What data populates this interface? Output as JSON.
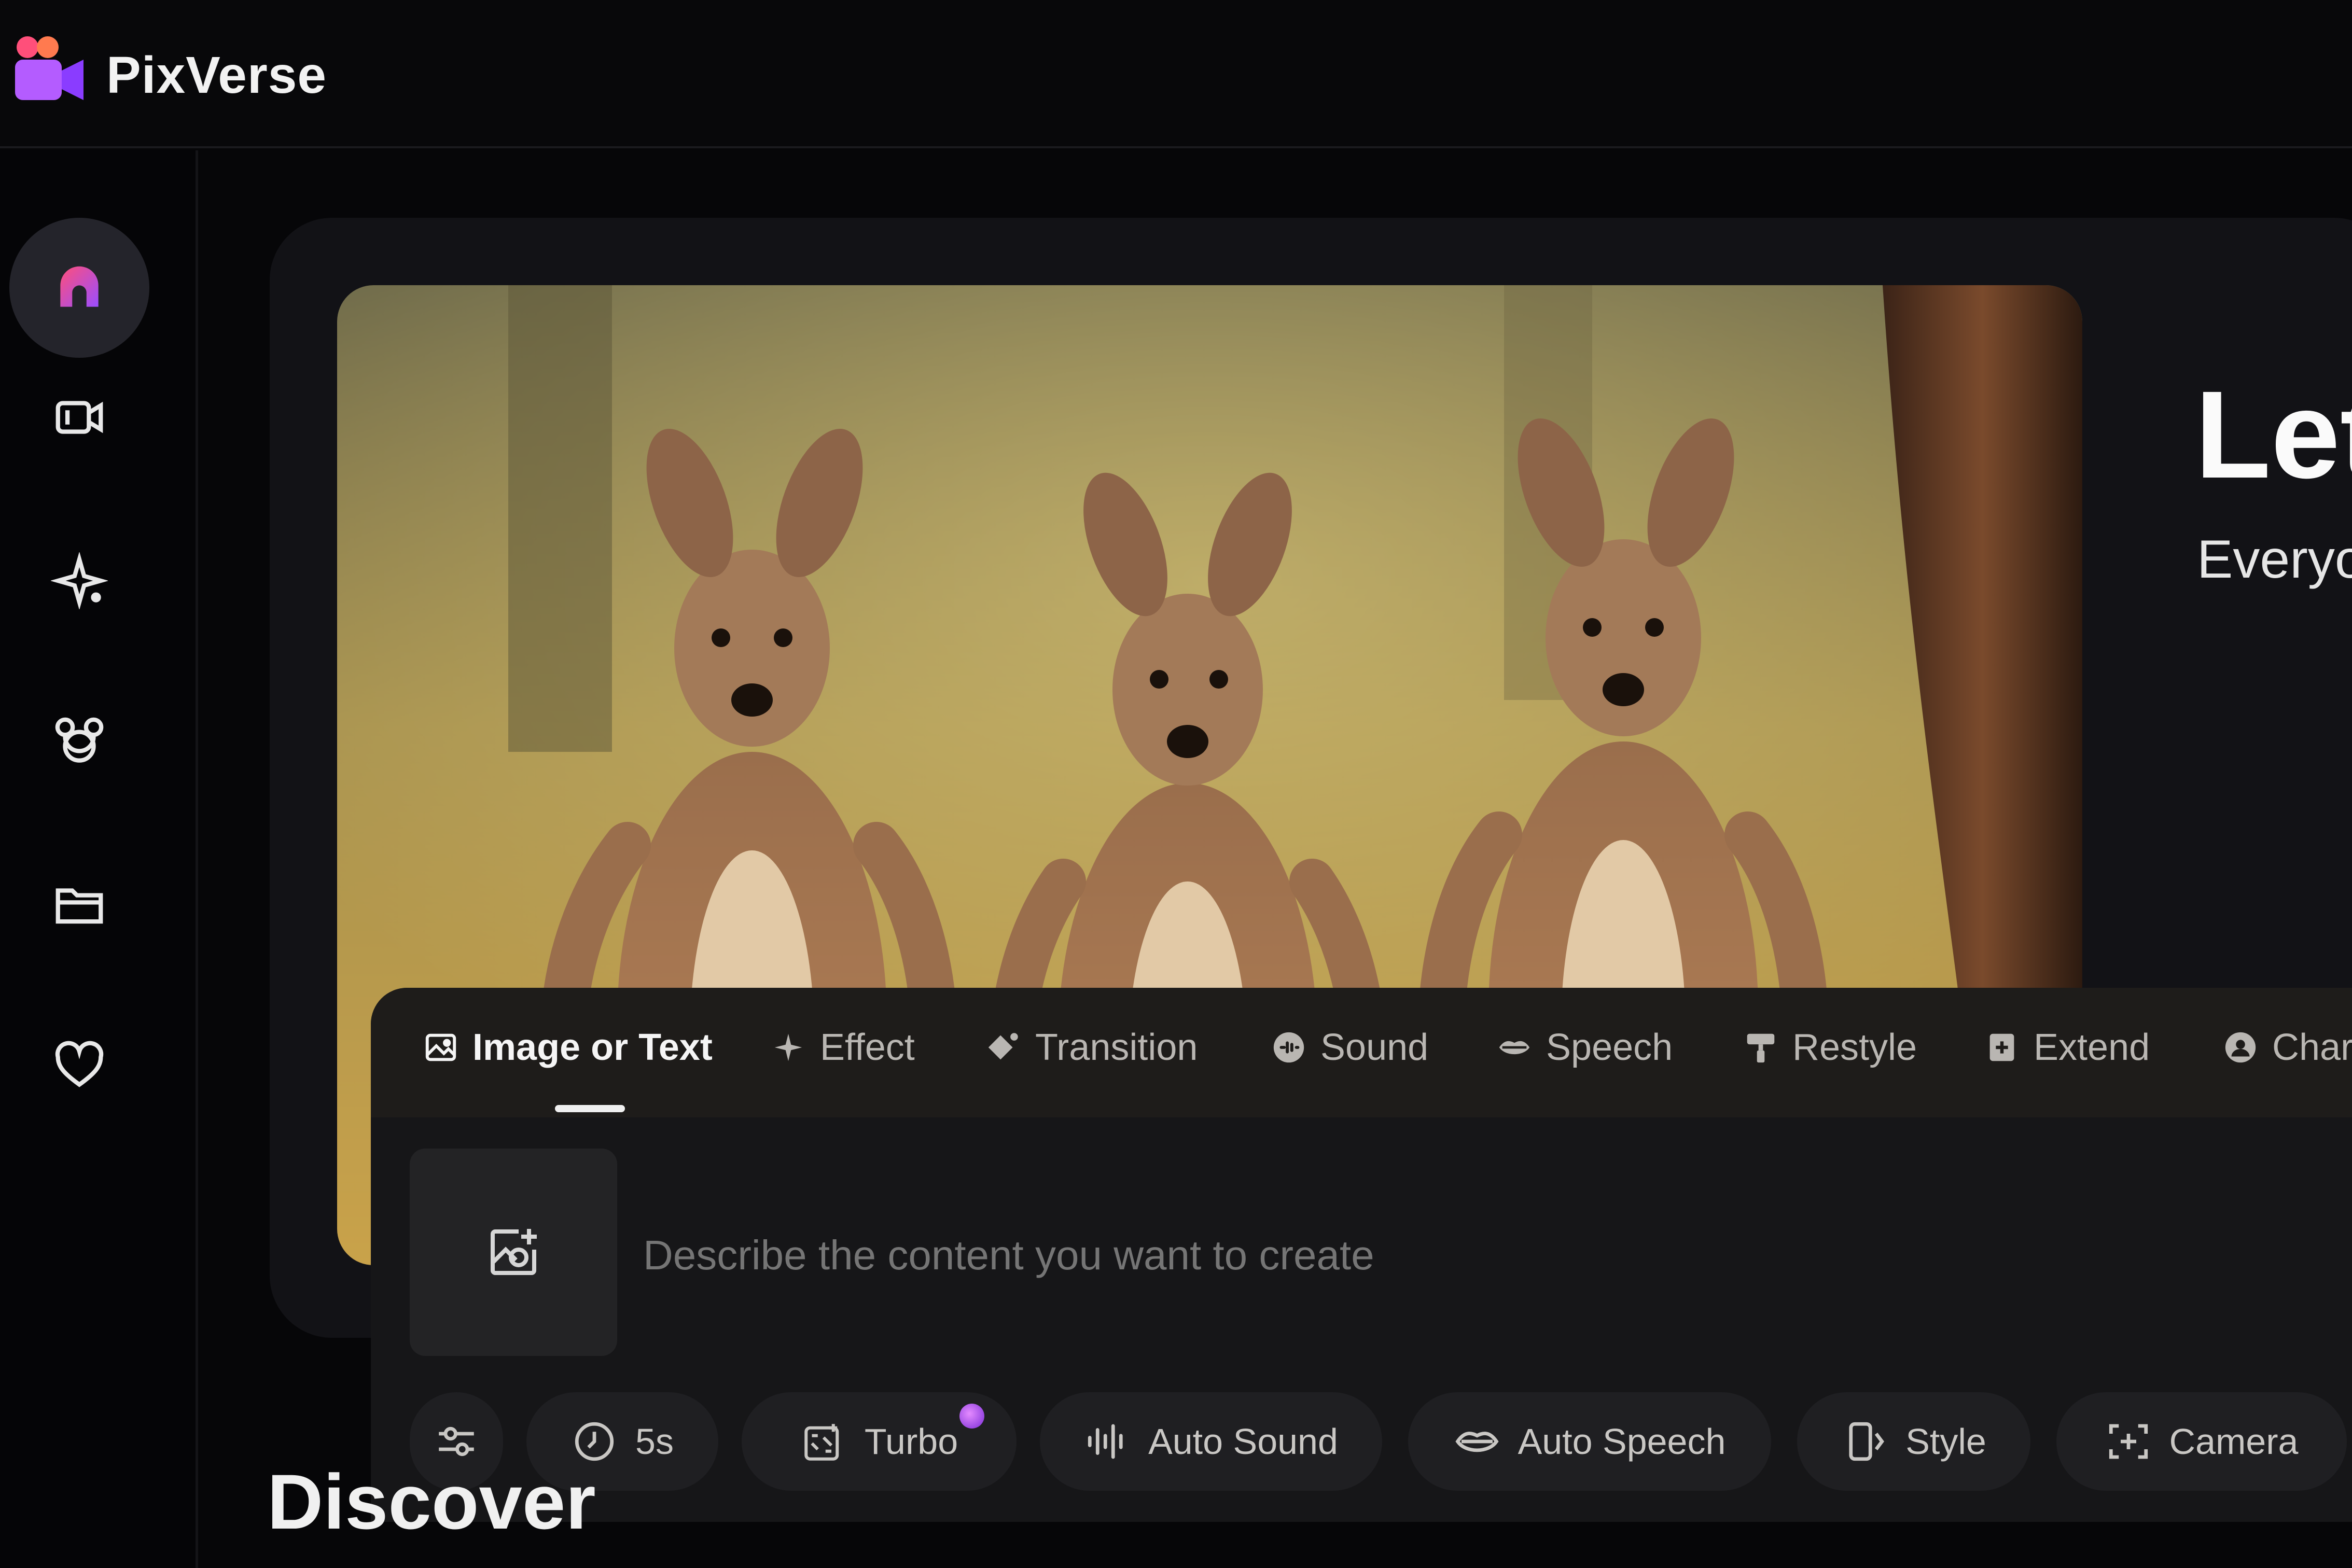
{
  "app": {
    "brand": "PixVerse",
    "colors": {
      "accent": "#9b4dff",
      "brand_pink": "#ff4f7a",
      "bg": "#060608"
    }
  },
  "sidebar": {
    "items": [
      {
        "name": "home",
        "icon": "home-icon",
        "active": true
      },
      {
        "name": "video",
        "icon": "video-camera-icon"
      },
      {
        "name": "effects",
        "icon": "sparkle-icon"
      },
      {
        "name": "characters",
        "icon": "mouse-ears-icon"
      },
      {
        "name": "assets",
        "icon": "folder-icon"
      },
      {
        "name": "favorites",
        "icon": "heart-icon"
      }
    ]
  },
  "hero": {
    "title": "Let",
    "subtitle": "Everyo"
  },
  "panel": {
    "tabs": [
      {
        "label": "Image or Text",
        "icon": "image-icon",
        "active": true
      },
      {
        "label": "Effect",
        "icon": "sparkle-icon"
      },
      {
        "label": "Transition",
        "icon": "transition-icon"
      },
      {
        "label": "Sound",
        "icon": "sound-icon"
      },
      {
        "label": "Speech",
        "icon": "lips-icon"
      },
      {
        "label": "Restyle",
        "icon": "paint-roller-icon"
      },
      {
        "label": "Extend",
        "icon": "extend-icon"
      },
      {
        "label": "Char",
        "icon": "character-icon"
      }
    ],
    "prompt_placeholder": "Describe the content you want to create",
    "options": {
      "duration": "5s",
      "mode": "Turbo",
      "auto_sound": "Auto Sound",
      "auto_speech": "Auto Speech",
      "style": "Style",
      "camera": "Camera"
    }
  },
  "discover": {
    "heading": "Discover"
  }
}
